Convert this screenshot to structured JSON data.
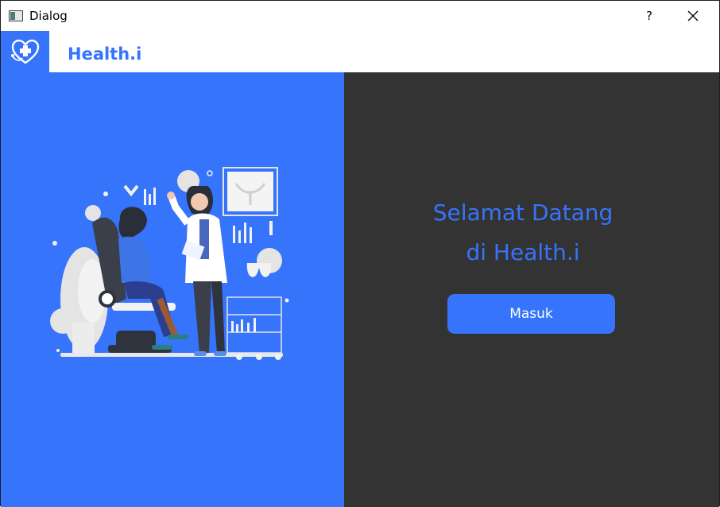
{
  "window": {
    "title": "Dialog",
    "help_label": "?",
    "close_icon": "close-icon"
  },
  "header": {
    "brand": "Health.i",
    "logo_icon": "heart-stethoscope-icon"
  },
  "welcome": {
    "line1": "Selamat Datang",
    "line2": "di Health.i"
  },
  "login_button": {
    "label": "Masuk"
  },
  "colors": {
    "primary": "#3574fb",
    "dark_panel": "#333333",
    "white": "#ffffff"
  }
}
